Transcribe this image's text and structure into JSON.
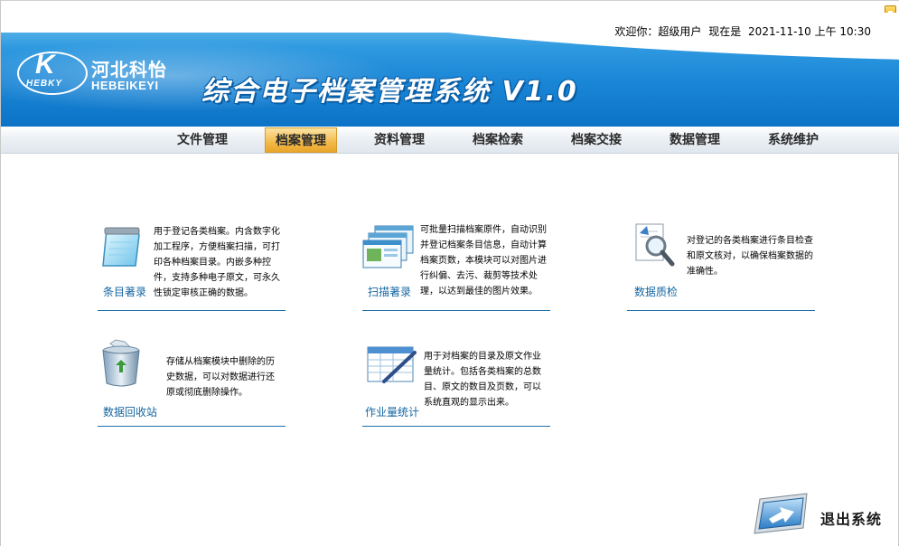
{
  "header": {
    "welcome": "欢迎你：超级用户",
    "now_label": "现在是",
    "datetime": "2021-11-10 上午 10:30",
    "logo_cn": "河北科怡",
    "logo_en": "HEBEIKEYI",
    "logo_mark": "HEBKY",
    "system_title": "综合电子档案管理系统 V1.0"
  },
  "nav": {
    "items": [
      "文件管理",
      "档案管理",
      "资料管理",
      "档案检索",
      "档案交接",
      "数据管理",
      "系统维护"
    ],
    "active": "档案管理"
  },
  "modules": [
    {
      "label": "条目著录",
      "icon": "notepad-icon",
      "desc": "用于登记各类档案。内含数字化加工程序，方便档案扫描，可打印各种档案目录。内嵌多种控件，支持多种电子原文，可永久性锁定审核正确的数据。"
    },
    {
      "label": "扫描著录",
      "icon": "scanned-windows-icon",
      "desc": "可批量扫描档案原件，自动识别并登记档案条目信息，自动计算档案页数，本模块可以对图片进行纠偏、去污、裁剪等技术处理，以达到最佳的图片效果。"
    },
    {
      "label": "数据质检",
      "icon": "magnifier-document-icon",
      "desc": "对登记的各类档案进行条目检查和原文核对，以确保档案数据的准确性。"
    },
    {
      "label": "数据回收站",
      "icon": "recycle-bin-icon",
      "desc": "存储从档案模块中删除的历史数据，可以对数据进行还原或彻底删除操作。"
    },
    {
      "label": "作业量统计",
      "icon": "spreadsheet-pen-icon",
      "desc": "用于对档案的目录及原文作业量统计。包括各类档案的总数目、原文的数目及页数，可以系统直观的显示出来。"
    }
  ],
  "exit": {
    "label": "退出系统",
    "icon": "exit-arrow-icon"
  },
  "colors": {
    "banner_blue": "#1a86d6",
    "nav_active": "#f2b94a",
    "module_label": "#1566a0"
  }
}
